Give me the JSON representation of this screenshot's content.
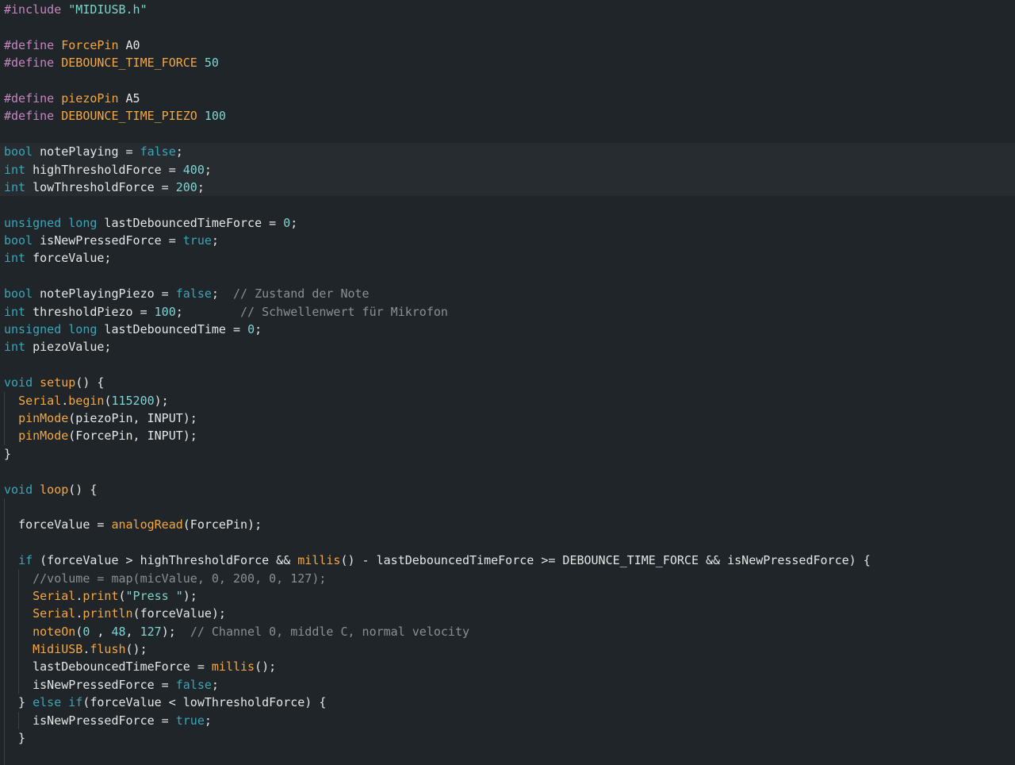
{
  "editor": {
    "language": "Arduino C++",
    "colors": {
      "background": "#1f2528",
      "preprocessor": "#c586c0",
      "macro_name": "#f5a742",
      "keyword": "#3aa6b9",
      "function": "#f5a742",
      "number": "#7fd4d4",
      "string": "#7ed4c8",
      "comment": "#8a8f93",
      "text": "#e6e6e6"
    },
    "lines": [
      {
        "tokens": [
          [
            "pp",
            "#include"
          ],
          [
            "plain",
            " "
          ],
          [
            "str",
            "\"MIDIUSB.h\""
          ]
        ]
      },
      {
        "tokens": []
      },
      {
        "tokens": [
          [
            "pp",
            "#define"
          ],
          [
            "plain",
            " "
          ],
          [
            "macro",
            "ForcePin"
          ],
          [
            "plain",
            " A0"
          ]
        ]
      },
      {
        "tokens": [
          [
            "pp",
            "#define"
          ],
          [
            "plain",
            " "
          ],
          [
            "macro",
            "DEBOUNCE_TIME_FORCE"
          ],
          [
            "plain",
            " "
          ],
          [
            "num",
            "50"
          ]
        ]
      },
      {
        "tokens": []
      },
      {
        "tokens": [
          [
            "pp",
            "#define"
          ],
          [
            "plain",
            " "
          ],
          [
            "macro",
            "piezoPin"
          ],
          [
            "plain",
            " A5"
          ]
        ]
      },
      {
        "tokens": [
          [
            "pp",
            "#define"
          ],
          [
            "plain",
            " "
          ],
          [
            "macro",
            "DEBOUNCE_TIME_PIEZO"
          ],
          [
            "plain",
            " "
          ],
          [
            "num",
            "100"
          ]
        ]
      },
      {
        "tokens": []
      },
      {
        "tokens": [
          [
            "kw",
            "bool"
          ],
          [
            "plain",
            " notePlaying = "
          ],
          [
            "kw",
            "false"
          ],
          [
            "plain",
            ";"
          ]
        ],
        "highlight": true
      },
      {
        "tokens": [
          [
            "kw",
            "int"
          ],
          [
            "plain",
            " highThresholdForce = "
          ],
          [
            "num",
            "400"
          ],
          [
            "plain",
            ";"
          ]
        ],
        "highlight": true
      },
      {
        "tokens": [
          [
            "kw",
            "int"
          ],
          [
            "plain",
            " lowThresholdForce = "
          ],
          [
            "num",
            "200"
          ],
          [
            "plain",
            ";"
          ]
        ],
        "highlight": true
      },
      {
        "tokens": []
      },
      {
        "tokens": [
          [
            "kw",
            "unsigned"
          ],
          [
            "plain",
            " "
          ],
          [
            "kw",
            "long"
          ],
          [
            "plain",
            " lastDebouncedTimeForce = "
          ],
          [
            "num",
            "0"
          ],
          [
            "plain",
            ";"
          ]
        ]
      },
      {
        "tokens": [
          [
            "kw",
            "bool"
          ],
          [
            "plain",
            " isNewPressedForce = "
          ],
          [
            "kw",
            "true"
          ],
          [
            "plain",
            ";"
          ]
        ]
      },
      {
        "tokens": [
          [
            "kw",
            "int"
          ],
          [
            "plain",
            " forceValue;"
          ]
        ]
      },
      {
        "tokens": []
      },
      {
        "tokens": [
          [
            "kw",
            "bool"
          ],
          [
            "plain",
            " notePlayingPiezo = "
          ],
          [
            "kw",
            "false"
          ],
          [
            "plain",
            ";  "
          ],
          [
            "cmt",
            "// Zustand der Note"
          ]
        ]
      },
      {
        "tokens": [
          [
            "kw",
            "int"
          ],
          [
            "plain",
            " thresholdPiezo = "
          ],
          [
            "num",
            "100"
          ],
          [
            "plain",
            ";        "
          ],
          [
            "cmt",
            "// Schwellenwert für Mikrofon"
          ]
        ]
      },
      {
        "tokens": [
          [
            "kw",
            "unsigned"
          ],
          [
            "plain",
            " "
          ],
          [
            "kw",
            "long"
          ],
          [
            "plain",
            " lastDebouncedTime = "
          ],
          [
            "num",
            "0"
          ],
          [
            "plain",
            ";"
          ]
        ]
      },
      {
        "tokens": [
          [
            "kw",
            "int"
          ],
          [
            "plain",
            " piezoValue;"
          ]
        ]
      },
      {
        "tokens": []
      },
      {
        "tokens": [
          [
            "kw",
            "void"
          ],
          [
            "plain",
            " "
          ],
          [
            "fn",
            "setup"
          ],
          [
            "plain",
            "() {"
          ]
        ]
      },
      {
        "tokens": [
          [
            "plain",
            "  "
          ],
          [
            "fn",
            "Serial"
          ],
          [
            "plain",
            "."
          ],
          [
            "fn",
            "begin"
          ],
          [
            "plain",
            "("
          ],
          [
            "num",
            "115200"
          ],
          [
            "plain",
            ");"
          ]
        ],
        "guides": [
          1
        ]
      },
      {
        "tokens": [
          [
            "plain",
            "  "
          ],
          [
            "fn",
            "pinMode"
          ],
          [
            "plain",
            "(piezoPin, INPUT);"
          ]
        ],
        "guides": [
          1
        ]
      },
      {
        "tokens": [
          [
            "plain",
            "  "
          ],
          [
            "fn",
            "pinMode"
          ],
          [
            "plain",
            "(ForcePin, INPUT);"
          ]
        ],
        "guides": [
          1
        ]
      },
      {
        "tokens": [
          [
            "plain",
            "}"
          ]
        ]
      },
      {
        "tokens": []
      },
      {
        "tokens": [
          [
            "kw",
            "void"
          ],
          [
            "plain",
            " "
          ],
          [
            "fn",
            "loop"
          ],
          [
            "plain",
            "() {"
          ]
        ]
      },
      {
        "tokens": [],
        "guides": [
          1
        ]
      },
      {
        "tokens": [
          [
            "plain",
            "  forceValue = "
          ],
          [
            "fn",
            "analogRead"
          ],
          [
            "plain",
            "(ForcePin);"
          ]
        ],
        "guides": [
          1
        ]
      },
      {
        "tokens": [],
        "guides": [
          1
        ]
      },
      {
        "tokens": [
          [
            "plain",
            "  "
          ],
          [
            "kw",
            "if"
          ],
          [
            "plain",
            " (forceValue > highThresholdForce && "
          ],
          [
            "fn",
            "millis"
          ],
          [
            "plain",
            "() - lastDebouncedTimeForce >= DEBOUNCE_TIME_FORCE && isNewPressedForce) {"
          ]
        ],
        "guides": [
          1
        ]
      },
      {
        "tokens": [
          [
            "plain",
            "    "
          ],
          [
            "cmt",
            "//volume = map(micValue, 0, 200, 0, 127);"
          ]
        ],
        "guides": [
          1,
          2
        ]
      },
      {
        "tokens": [
          [
            "plain",
            "    "
          ],
          [
            "fn",
            "Serial"
          ],
          [
            "plain",
            "."
          ],
          [
            "fn",
            "print"
          ],
          [
            "plain",
            "("
          ],
          [
            "str",
            "\"Press \""
          ],
          [
            "plain",
            ");"
          ]
        ],
        "guides": [
          1,
          2
        ]
      },
      {
        "tokens": [
          [
            "plain",
            "    "
          ],
          [
            "fn",
            "Serial"
          ],
          [
            "plain",
            "."
          ],
          [
            "fn",
            "println"
          ],
          [
            "plain",
            "(forceValue);"
          ]
        ],
        "guides": [
          1,
          2
        ]
      },
      {
        "tokens": [
          [
            "plain",
            "    "
          ],
          [
            "fn",
            "noteOn"
          ],
          [
            "plain",
            "("
          ],
          [
            "num",
            "0"
          ],
          [
            "plain",
            " , "
          ],
          [
            "num",
            "48"
          ],
          [
            "plain",
            ", "
          ],
          [
            "num",
            "127"
          ],
          [
            "plain",
            ");  "
          ],
          [
            "cmt",
            "// Channel 0, middle C, normal velocity"
          ]
        ],
        "guides": [
          1,
          2
        ]
      },
      {
        "tokens": [
          [
            "plain",
            "    "
          ],
          [
            "fn",
            "MidiUSB"
          ],
          [
            "plain",
            "."
          ],
          [
            "fn",
            "flush"
          ],
          [
            "plain",
            "();"
          ]
        ],
        "guides": [
          1,
          2
        ]
      },
      {
        "tokens": [
          [
            "plain",
            "    lastDebouncedTimeForce = "
          ],
          [
            "fn",
            "millis"
          ],
          [
            "plain",
            "();"
          ]
        ],
        "guides": [
          1,
          2
        ]
      },
      {
        "tokens": [
          [
            "plain",
            "    isNewPressedForce = "
          ],
          [
            "kw",
            "false"
          ],
          [
            "plain",
            ";"
          ]
        ],
        "guides": [
          1,
          2
        ]
      },
      {
        "tokens": [
          [
            "plain",
            "  } "
          ],
          [
            "kw",
            "else"
          ],
          [
            "plain",
            " "
          ],
          [
            "kw",
            "if"
          ],
          [
            "plain",
            "(forceValue < lowThresholdForce) {"
          ]
        ],
        "guides": [
          1
        ]
      },
      {
        "tokens": [
          [
            "plain",
            "    isNewPressedForce = "
          ],
          [
            "kw",
            "true"
          ],
          [
            "plain",
            ";"
          ]
        ],
        "guides": [
          1,
          2
        ]
      },
      {
        "tokens": [
          [
            "plain",
            "  }"
          ]
        ],
        "guides": [
          1
        ]
      },
      {
        "tokens": [],
        "guides": [
          1
        ]
      }
    ]
  }
}
